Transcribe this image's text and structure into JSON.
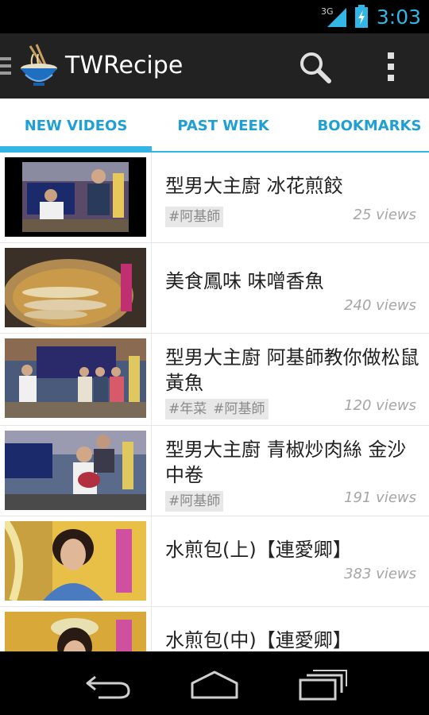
{
  "status_bar": {
    "network": "3G",
    "time": "3:03"
  },
  "app": {
    "title": "TWRecipe",
    "icons": [
      "drawer-indicator-icon",
      "noodle-bowl-icon",
      "search-icon",
      "overflow-menu-icon"
    ]
  },
  "tabs": [
    {
      "label": "NEW VIDEOS",
      "selected": true
    },
    {
      "label": "PAST WEEK",
      "selected": false
    },
    {
      "label": "BOOKMARKS",
      "selected": false
    }
  ],
  "videos": [
    {
      "title": "型男大主廚 冰花煎餃",
      "tags": [
        "#阿基師"
      ],
      "views": "25 views"
    },
    {
      "title": "美食鳳味 味噌香魚",
      "tags": [],
      "views": "240 views"
    },
    {
      "title": "型男大主廚 阿基師教你做松鼠黃魚",
      "tags": [
        "#年菜",
        "#阿基師"
      ],
      "views": "120 views"
    },
    {
      "title": "型男大主廚 青椒炒肉絲 金沙中卷",
      "tags": [
        "#阿基師"
      ],
      "views": "191 views"
    },
    {
      "title": "水煎包(上)【連愛卿】",
      "tags": [],
      "views": "383 views"
    },
    {
      "title": "水煎包(中)【連愛卿】",
      "tags": [],
      "views": ""
    }
  ],
  "nav": {
    "icons": [
      "back-icon",
      "home-icon",
      "recent-apps-icon"
    ]
  },
  "colors": {
    "accent": "#33b5e5",
    "tab_text": "#1ea0d6",
    "action_bar": "#222222"
  }
}
